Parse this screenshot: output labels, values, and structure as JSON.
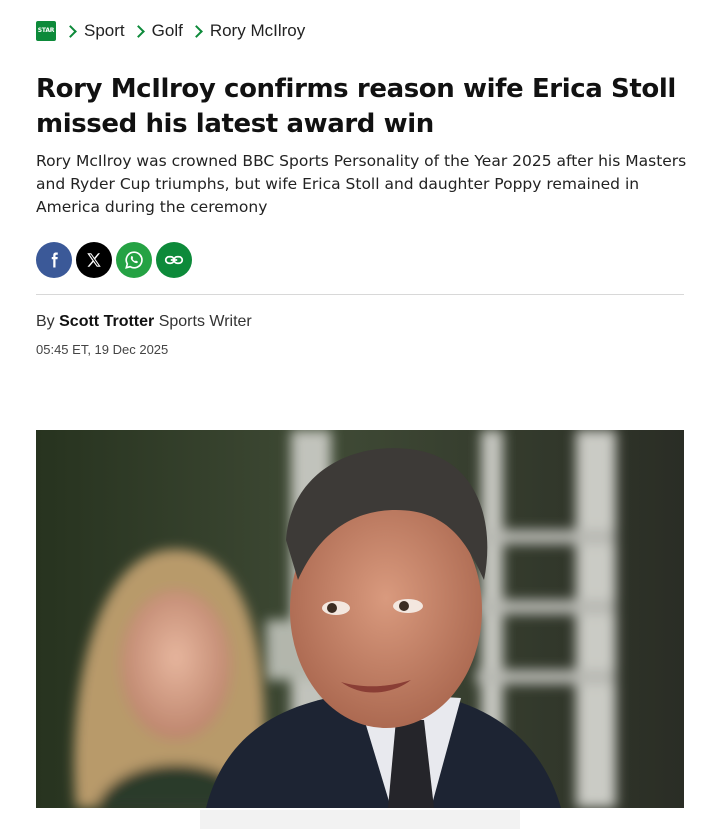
{
  "site": {
    "logo_text": "STAR"
  },
  "breadcrumb": {
    "items": [
      "Sport",
      "Golf",
      "Rory McIlroy"
    ]
  },
  "article": {
    "headline": "Rory McIlroy confirms reason wife Erica Stoll missed his latest award win",
    "standfirst": "Rory McIlroy was crowned BBC Sports Personality of the Year 2025 after his Masters and Ryder Cup triumphs, but wife Erica Stoll and daughter Poppy remained in America during the ceremony",
    "byline_prefix": "By",
    "author": "Scott Trotter",
    "author_role": "Sports Writer",
    "timestamp": "05:45 ET, 19 Dec 2025"
  },
  "share": {
    "buttons": [
      {
        "icon": "facebook-icon",
        "color": "#3b5998"
      },
      {
        "icon": "x-icon",
        "color": "#000000"
      },
      {
        "icon": "whatsapp-icon",
        "color": "#25a244"
      },
      {
        "icon": "link-icon",
        "color": "#0d8a3a"
      }
    ]
  },
  "colors": {
    "brand": "#0d8a3a",
    "text": "#111111",
    "divider": "#d8d8d8"
  }
}
